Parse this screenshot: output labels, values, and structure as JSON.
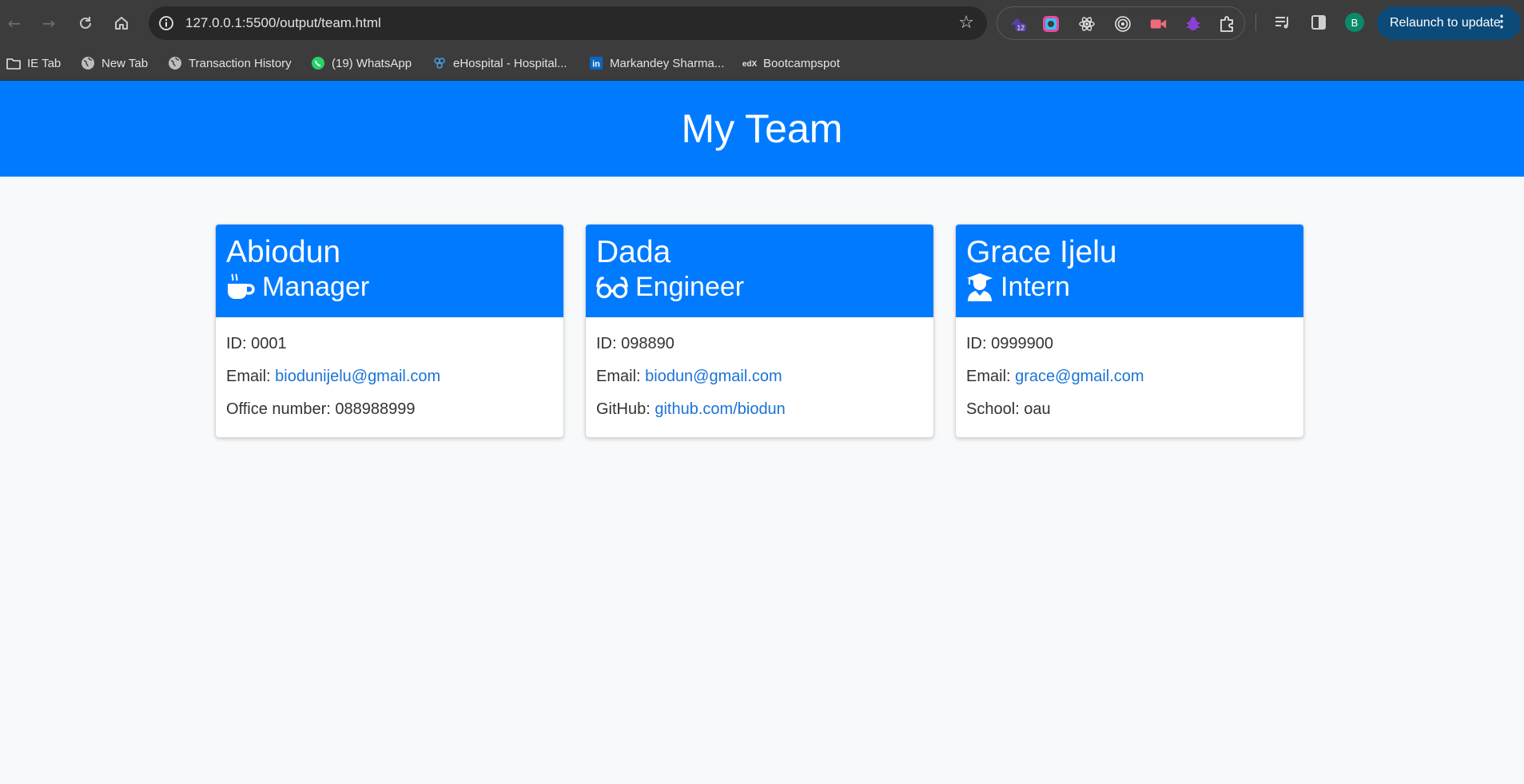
{
  "browser": {
    "url": "127.0.0.1:5500/output/team.html",
    "extension_badge": "12",
    "profile_initial": "B",
    "relaunch_label": "Relaunch to update",
    "bookmarks": [
      {
        "label": "IE Tab",
        "icon": "folder-icon"
      },
      {
        "label": "New Tab",
        "icon": "globe-icon"
      },
      {
        "label": "Transaction History",
        "icon": "globe-icon"
      },
      {
        "label": "(19) WhatsApp",
        "icon": "whatsapp-icon"
      },
      {
        "label": "eHospital - Hospital...",
        "icon": "ehospital-icon"
      },
      {
        "label": "Markandey Sharma...",
        "icon": "linkedin-icon"
      },
      {
        "label": "Bootcampspot",
        "icon": "edx-icon"
      }
    ]
  },
  "page": {
    "title": "My Team",
    "header_color": "#007bff",
    "link_color": "#1a73d8"
  },
  "team": [
    {
      "name": "Abiodun",
      "role": "Manager",
      "role_icon": "coffee-mug-icon",
      "id_label": "ID: ",
      "id": "0001",
      "email_label": "Email: ",
      "email": "biodunijelu@gmail.com",
      "extra_label": "Office number: ",
      "extra_value": "088988999"
    },
    {
      "name": "Dada",
      "role": "Engineer",
      "role_icon": "glasses-icon",
      "id_label": "ID: ",
      "id": "098890",
      "email_label": "Email: ",
      "email": "biodun@gmail.com",
      "extra_label": "GitHub: ",
      "extra_value": "github.com/biodun"
    },
    {
      "name": "Grace Ijelu",
      "role": "Intern",
      "role_icon": "graduate-icon",
      "id_label": "ID: ",
      "id": "0999900",
      "email_label": "Email: ",
      "email": "grace@gmail.com",
      "extra_label": "School: ",
      "extra_value": "oau"
    }
  ]
}
